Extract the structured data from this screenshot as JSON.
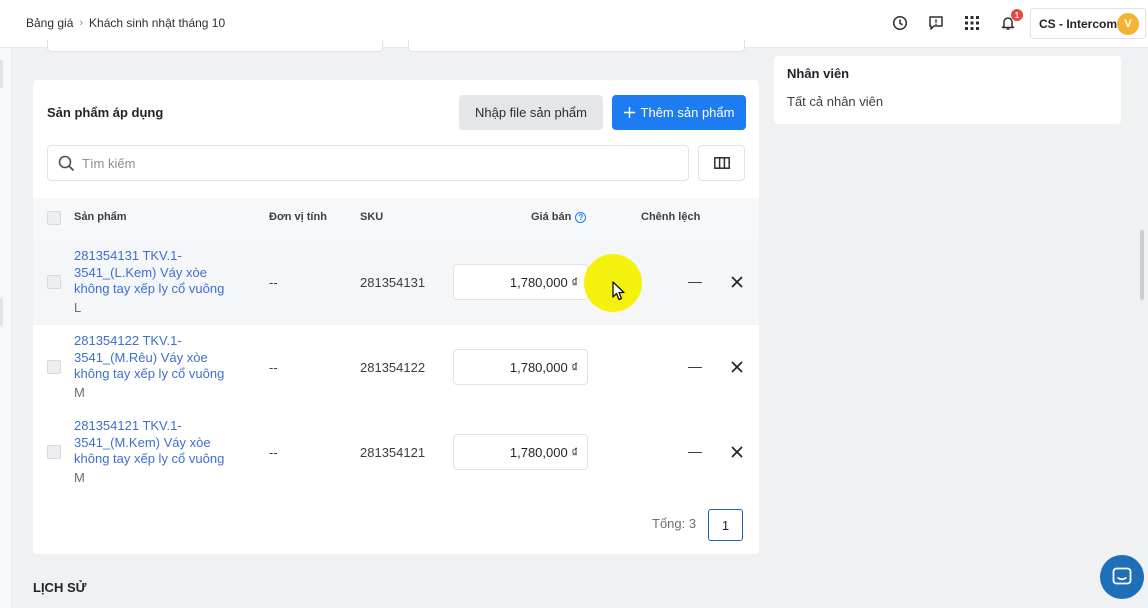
{
  "header": {
    "breadcrumb": [
      "Bảng giá",
      "Khách sinh nhật tháng 10"
    ],
    "notification_count": "1",
    "account_name": "CS - Intercom",
    "avatar_initial": "V"
  },
  "products_card": {
    "title": "Sản phẩm áp dụng",
    "import_button": "Nhập file sản phẩm",
    "add_button": "Thêm sản phẩm",
    "search_placeholder": "Tìm kiếm",
    "columns": [
      "Sản phẩm",
      "Đơn vị tính",
      "SKU",
      "Giá bán",
      "Chênh lệch"
    ],
    "rows": [
      {
        "name": "281354131 TKV.1-3541_(L.Kem) Váy xòe không tay xếp ly cổ vuông",
        "variant": "L",
        "unit": "--",
        "sku": "281354131",
        "price": "1,780,000 ₫"
      },
      {
        "name": "281354122 TKV.1-3541_(M.Rêu) Váy xòe không tay xếp ly cổ vuông",
        "variant": "M",
        "unit": "--",
        "sku": "281354122",
        "price": "1,780,000 ₫"
      },
      {
        "name": "281354121 TKV.1-3541_(M.Kem) Váy xòe không tay xếp ly cổ vuông",
        "variant": "M",
        "unit": "--",
        "sku": "281354121",
        "price": "1,780,000 ₫"
      }
    ],
    "total_label": "Tổng: 3",
    "current_page": "1"
  },
  "history_title": "LỊCH SỬ",
  "staff_card": {
    "label": "Nhân viên",
    "value": "Tất cả nhân viên"
  },
  "colors": {
    "primary": "#1e7cf2",
    "link": "#3b6fd1",
    "badge": "#e5483e",
    "avatar": "#f5b335",
    "cursor_highlight": "#f4f20c"
  }
}
